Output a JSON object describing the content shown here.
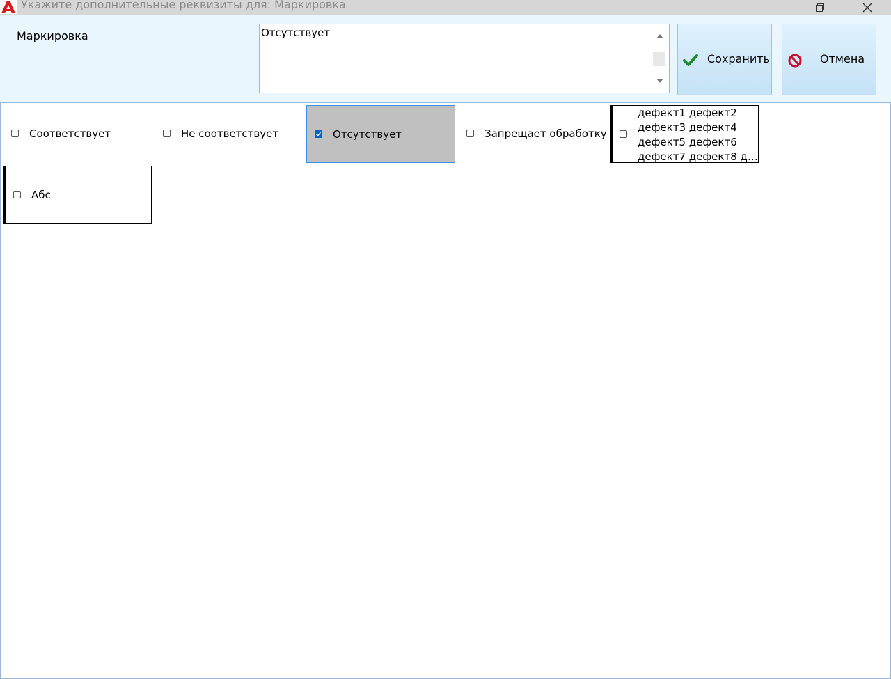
{
  "window": {
    "title": "Укажите дополнительные реквизиты для: Маркировка",
    "app_icon": "app-logo-icon",
    "controls": [
      "restore-icon",
      "close-icon"
    ]
  },
  "header": {
    "field_label": "Маркировка",
    "field_value": "Отсутствует",
    "save_label": "Сохранить",
    "cancel_label": "Отмена",
    "save_icon": "checkmark-icon",
    "cancel_icon": "no-entry-icon"
  },
  "options": [
    {
      "label": "Соответствует",
      "checked": false
    },
    {
      "label": "Не соответствует",
      "checked": false
    },
    {
      "label": "Отсутствует",
      "checked": true
    },
    {
      "label": "Запрещает обработку",
      "checked": false
    },
    {
      "lines": [
        "дефект1 дефект2",
        "дефект3 дефект4",
        "дефект5 дефект6",
        "дефект7 дефект8 де..."
      ],
      "checked": false
    },
    {
      "label": "Абс",
      "checked": false
    }
  ],
  "colors": {
    "header_bg": "#e9f6fd",
    "selected_tile_bg": "#c0c0c0",
    "checkbox_accent": "#0067c0",
    "save_check": "#1e8a2e",
    "cancel_red": "#c8102e"
  }
}
